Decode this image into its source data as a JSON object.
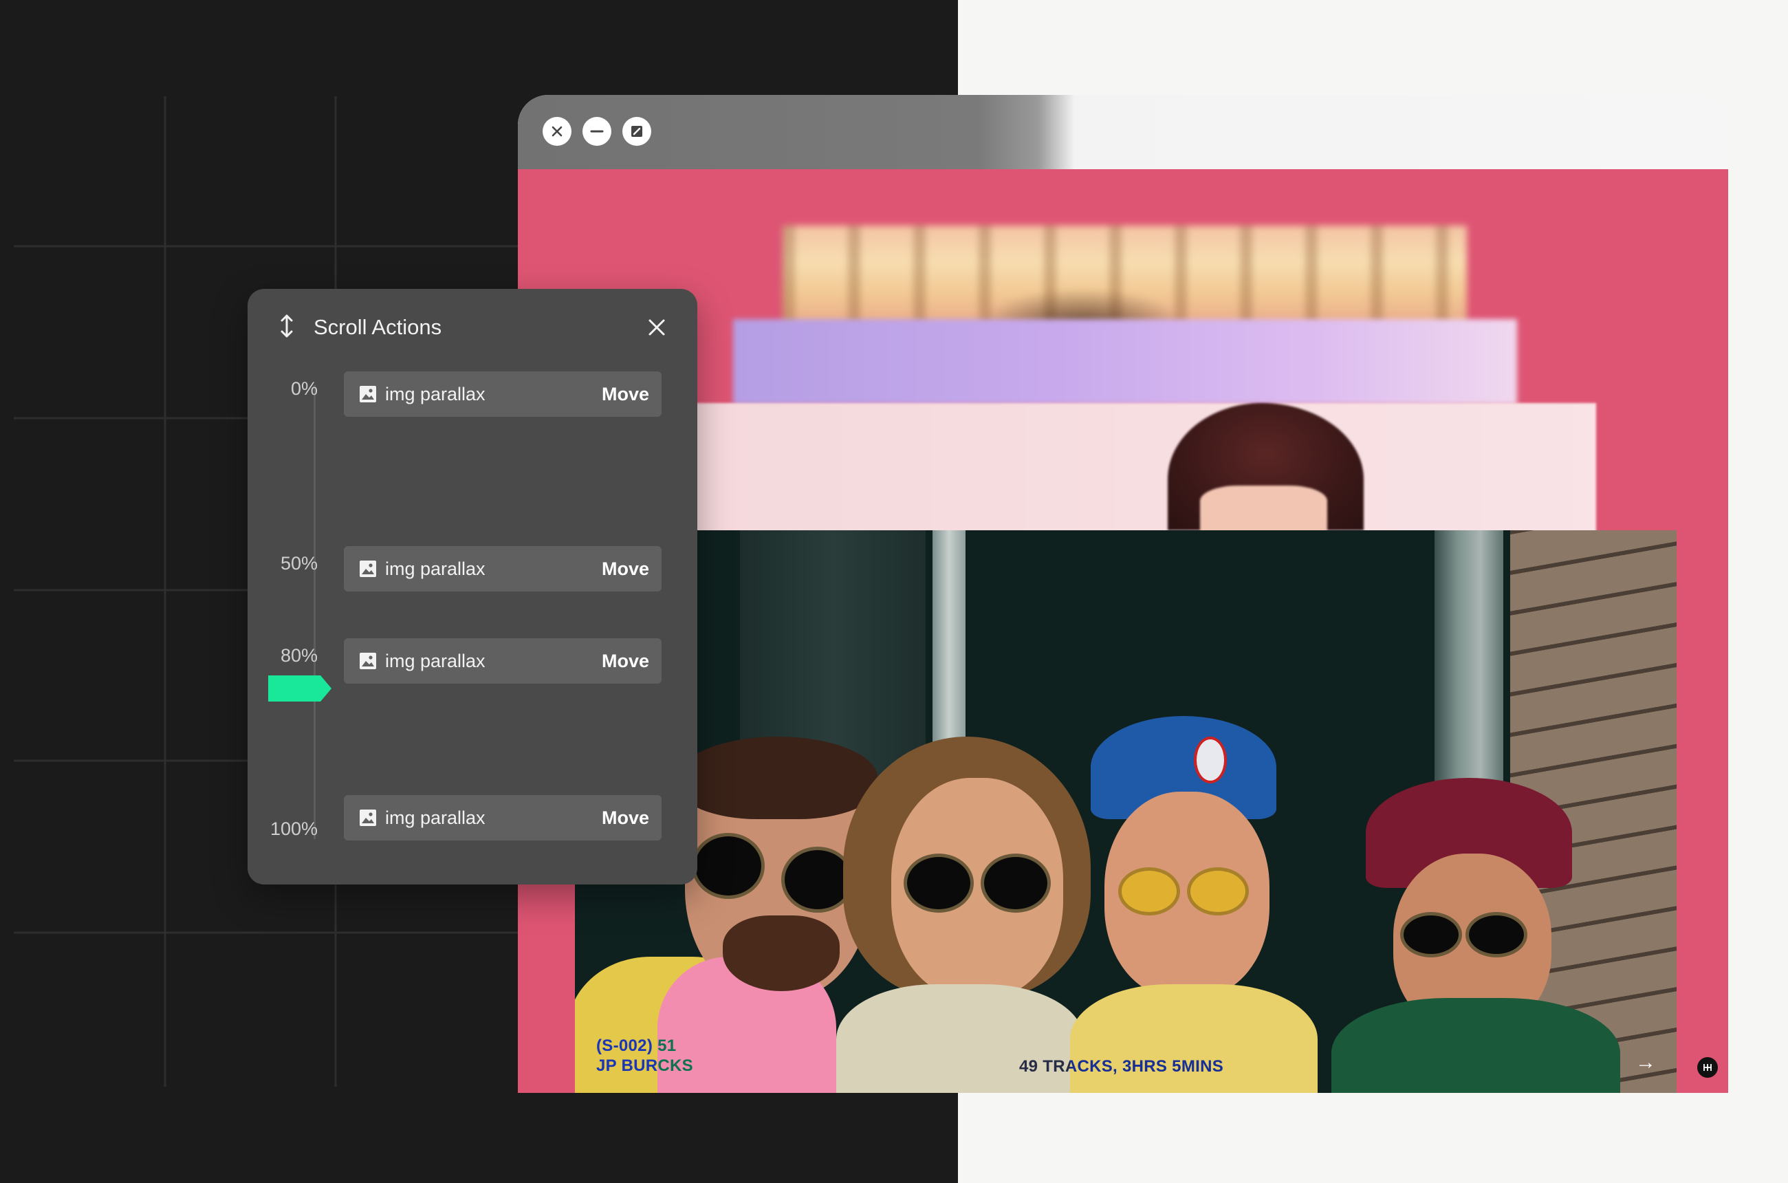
{
  "window_controls": {
    "close_icon": "close-icon",
    "minimize_icon": "minimize-icon",
    "expand_icon": "expand-icon"
  },
  "scroll_panel": {
    "title": "Scroll Actions",
    "header_icon": "vertical-arrows-icon",
    "close_icon": "close-icon",
    "marker_color": "#19e89a",
    "current_progress_percent": 80,
    "items": [
      {
        "percent": "0%",
        "label": "img parallax",
        "action": "Move",
        "icon": "image-icon"
      },
      {
        "percent": "50%",
        "label": "img parallax",
        "action": "Move",
        "icon": "image-icon"
      },
      {
        "percent": "80%",
        "label": "img parallax",
        "action": "Move",
        "icon": "image-icon"
      },
      {
        "percent": "100%",
        "label": "img parallax",
        "action": "Move",
        "icon": "image-icon"
      }
    ]
  },
  "site_preview": {
    "background_color": "#de5573",
    "meta_line1": "(S-002) 51",
    "meta_line2": "JP BURCKS",
    "tracks_text": "49 TRACKS, 3HRS 5MINS",
    "arrow_icon": "arrow-right-icon",
    "badge_icon": "logo-badge-icon"
  }
}
